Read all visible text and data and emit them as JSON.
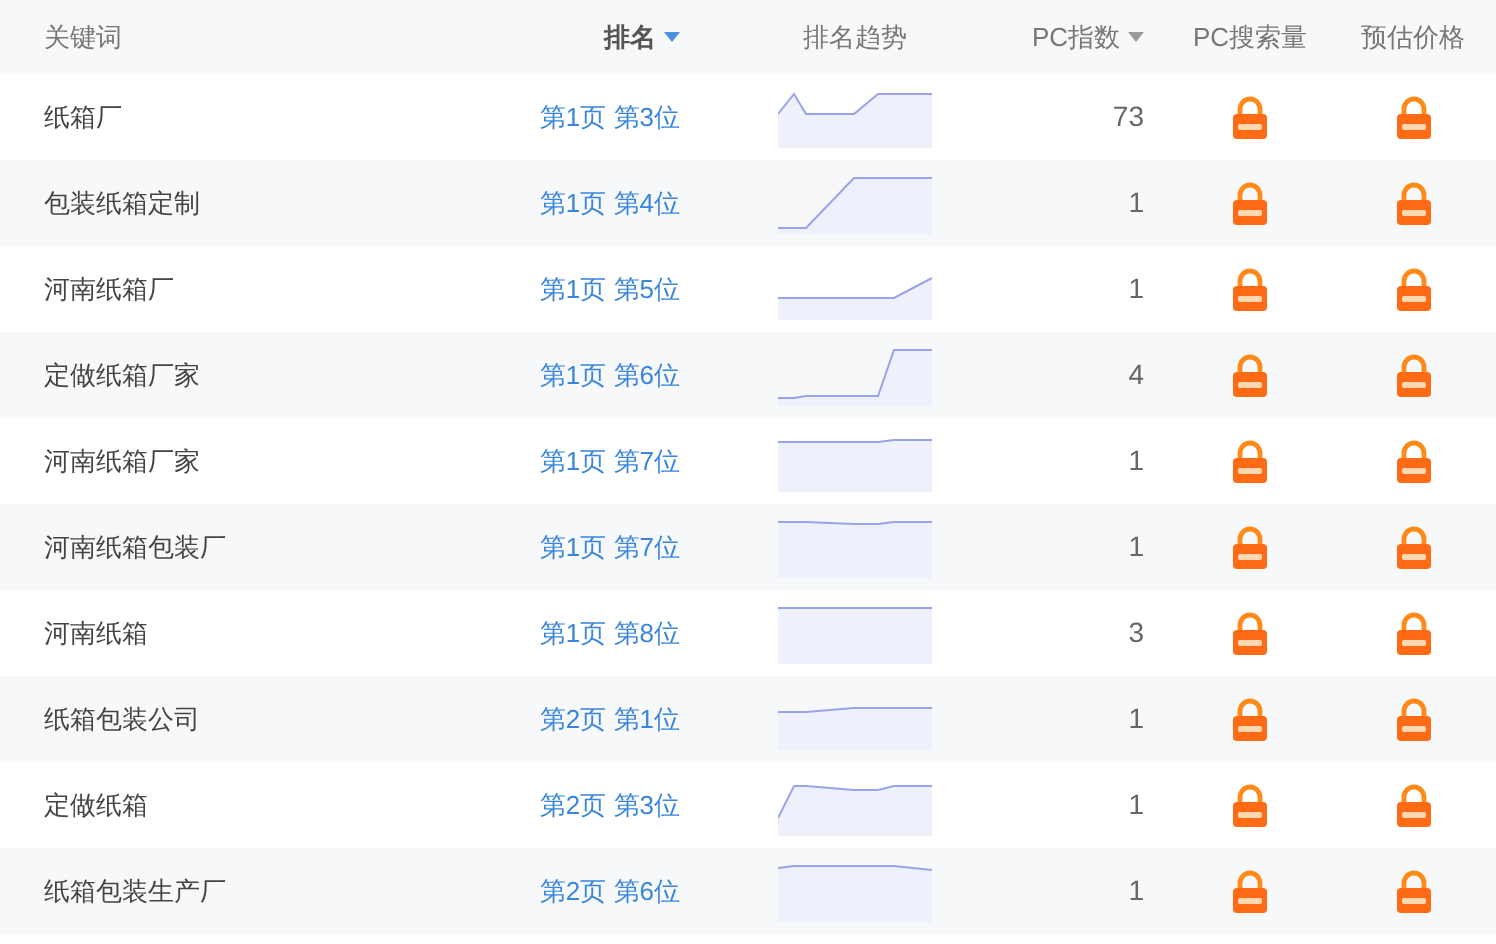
{
  "columns": [
    {
      "label": "关键词",
      "kind": "plain"
    },
    {
      "label": "排名",
      "kind": "sort",
      "sorted": true
    },
    {
      "label": "排名趋势",
      "kind": "plain"
    },
    {
      "label": "PC指数",
      "kind": "sort",
      "sorted": false
    },
    {
      "label": "PC搜索量",
      "kind": "plain"
    },
    {
      "label": "预估价格",
      "kind": "plain"
    }
  ],
  "rows": [
    {
      "keyword": "纸箱厂",
      "rank": "第1页 第3位",
      "pc_index": "73"
    },
    {
      "keyword": "包装纸箱定制",
      "rank": "第1页 第4位",
      "pc_index": "1"
    },
    {
      "keyword": "河南纸箱厂",
      "rank": "第1页 第5位",
      "pc_index": "1"
    },
    {
      "keyword": "定做纸箱厂家",
      "rank": "第1页 第6位",
      "pc_index": "4"
    },
    {
      "keyword": "河南纸箱厂家",
      "rank": "第1页 第7位",
      "pc_index": "1"
    },
    {
      "keyword": "河南纸箱包装厂",
      "rank": "第1页 第7位",
      "pc_index": "1"
    },
    {
      "keyword": "河南纸箱",
      "rank": "第1页 第8位",
      "pc_index": "3"
    },
    {
      "keyword": "纸箱包装公司",
      "rank": "第2页 第1位",
      "pc_index": "1"
    },
    {
      "keyword": "定做纸箱",
      "rank": "第2页 第3位",
      "pc_index": "1"
    },
    {
      "keyword": "纸箱包装生产厂",
      "rank": "第2页 第6位",
      "pc_index": "1"
    }
  ]
}
